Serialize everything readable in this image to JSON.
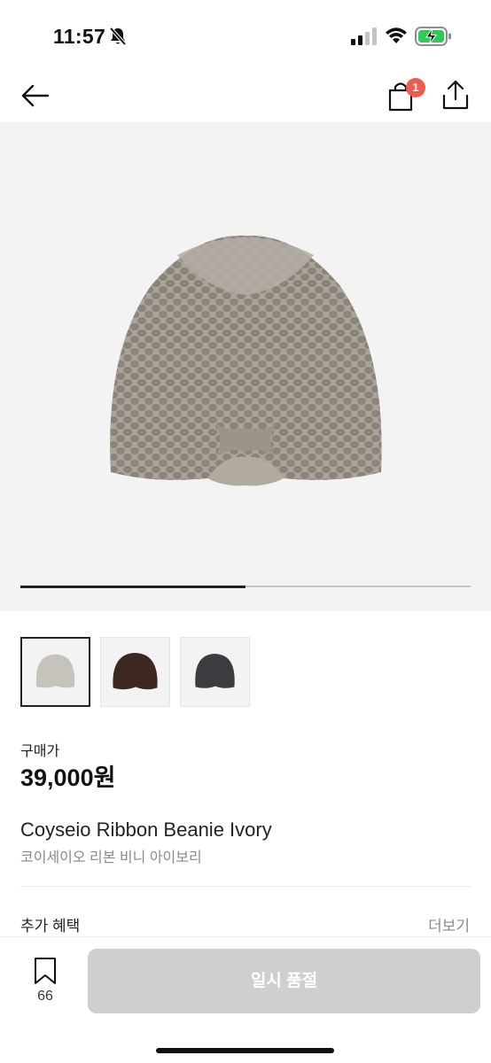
{
  "status_bar": {
    "time": "11:57",
    "icons": [
      "bell-slash-icon",
      "signal-icon",
      "wifi-icon",
      "battery-charging-icon"
    ]
  },
  "nav": {
    "icons": [
      "arrow-left-icon",
      "shopping-bag-icon",
      "share-icon"
    ],
    "cart_badge": "1"
  },
  "gallery": {
    "image_progress": 0.5,
    "thumbnails": [
      {
        "name": "ivory",
        "color": "#c6c3bd",
        "active": true
      },
      {
        "name": "brown",
        "color": "#3d2721",
        "active": false
      },
      {
        "name": "charcoal",
        "color": "#3a3c40",
        "active": false
      }
    ],
    "hero_color": "#a9a39a"
  },
  "price": {
    "label": "구매가",
    "value": "39,000원"
  },
  "product": {
    "name_en": "Coyseio Ribbon Beanie Ivory",
    "name_ko": "코이세이오 리본 비니 아이보리"
  },
  "benefits": {
    "title": "추가 혜택",
    "more": "더보기"
  },
  "bottom_bar": {
    "bookmark_count": "66",
    "soldout_label": "일시 품절"
  },
  "colors": {
    "badge": "#f05a4f",
    "soldout_bg": "#cfcfcf",
    "background": "#ffffff",
    "hero_bg": "#f3f3f3"
  }
}
